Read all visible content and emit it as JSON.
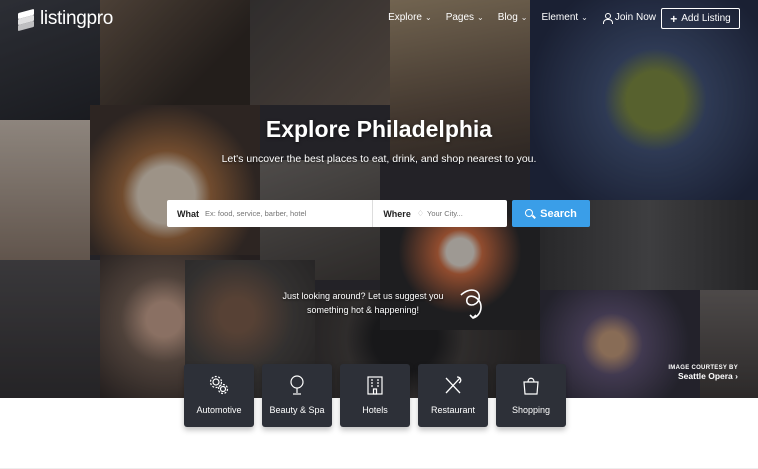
{
  "brand": {
    "logo_text": "listingpro"
  },
  "nav": {
    "items": [
      {
        "label": "Explore",
        "icon": "chevron-down-icon"
      },
      {
        "label": "Pages",
        "icon": "chevron-down-icon"
      },
      {
        "label": "Blog",
        "icon": "chevron-down-icon"
      },
      {
        "label": "Element",
        "icon": "chevron-down-icon"
      }
    ],
    "join_label": "Join Now",
    "add_listing_label": "Add Listing"
  },
  "hero": {
    "title": "Explore Philadelphia",
    "subtitle": "Let's uncover the best places to eat, drink, and shop nearest to you."
  },
  "search": {
    "what_label": "What",
    "what_placeholder": "Ex: food, service, barber, hotel",
    "where_label": "Where",
    "where_placeholder": "Your City...",
    "button_label": "Search",
    "button_color": "#3a9ee8"
  },
  "suggest": {
    "line1": "Just looking around? Let us suggest you",
    "line2": "something hot & happening!"
  },
  "courtesy": {
    "label": "IMAGE COURTESY BY",
    "source": "Seattle Opera"
  },
  "categories": [
    {
      "label": "Automotive",
      "icon": "cogs-icon"
    },
    {
      "label": "Beauty & Spa",
      "icon": "mirror-icon"
    },
    {
      "label": "Hotels",
      "icon": "building-icon"
    },
    {
      "label": "Restaurant",
      "icon": "utensils-icon"
    },
    {
      "label": "Shopping",
      "icon": "shopping-bag-icon"
    }
  ]
}
